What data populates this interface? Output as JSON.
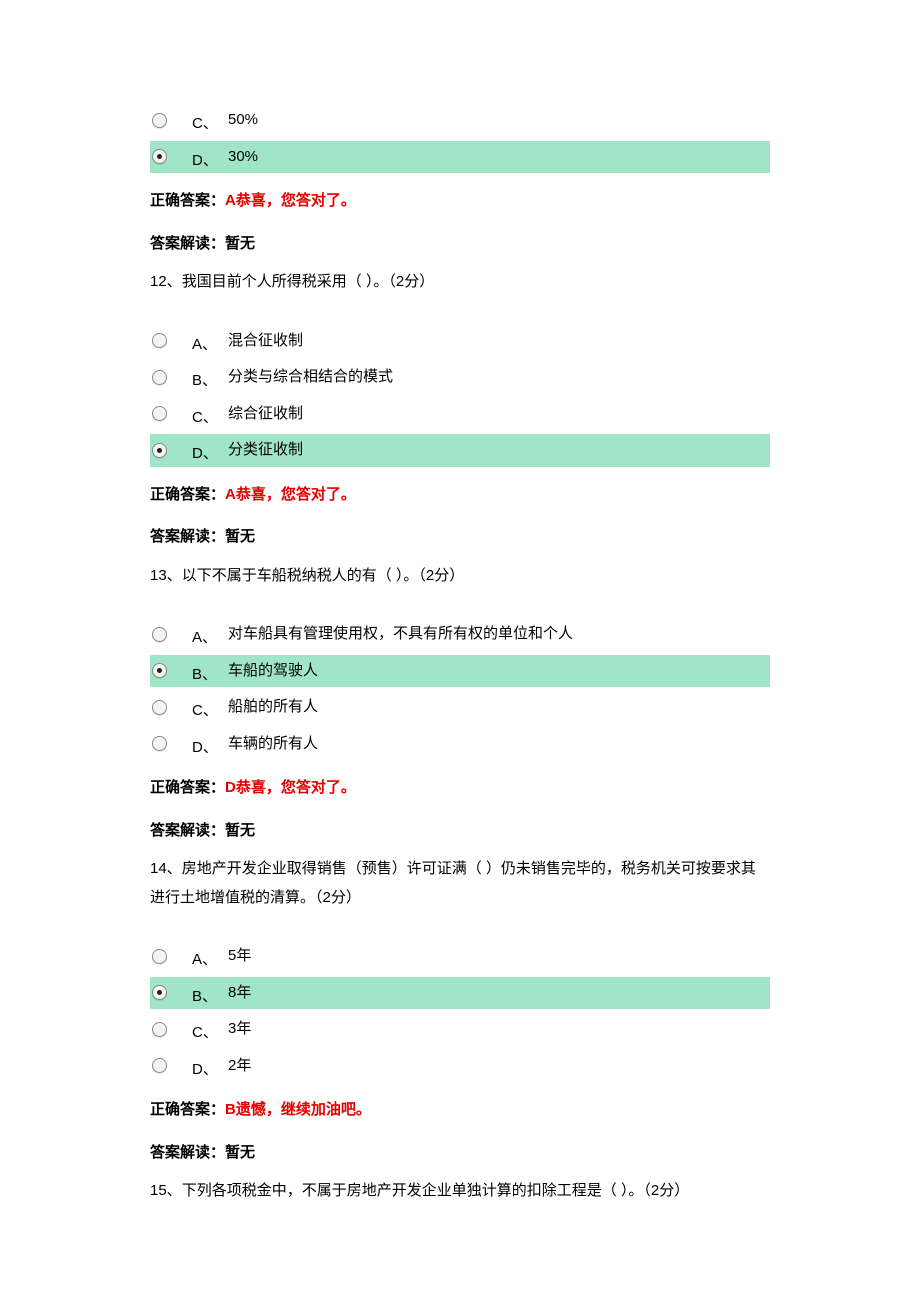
{
  "labels": {
    "correct_prefix": "正确答案：",
    "explain_prefix": "答案解读：",
    "explain_none": "暂无",
    "msg_correct": "恭喜，您答对了。",
    "msg_wrong": "遗憾，继续加油吧。"
  },
  "q_top": {
    "options": [
      {
        "letter": "C、",
        "text": "50%",
        "selected": false,
        "highlight": false
      },
      {
        "letter": "D、",
        "text": "30%",
        "selected": true,
        "highlight": true
      }
    ],
    "answer_key": "A",
    "answer_msg": "恭喜，您答对了。"
  },
  "q12": {
    "number": "12、",
    "stem": "我国目前个人所得税采用（ ）。（2分）",
    "options": [
      {
        "letter": "A、",
        "text": "混合征收制",
        "selected": false,
        "highlight": false
      },
      {
        "letter": "B、",
        "text": "分类与综合相结合的模式",
        "selected": false,
        "highlight": false
      },
      {
        "letter": "C、",
        "text": "综合征收制",
        "selected": false,
        "highlight": false
      },
      {
        "letter": "D、",
        "text": "分类征收制",
        "selected": true,
        "highlight": true
      }
    ],
    "answer_key": "A",
    "answer_msg": "恭喜，您答对了。"
  },
  "q13": {
    "number": "13、",
    "stem": "以下不属于车船税纳税人的有（ ）。（2分）",
    "options": [
      {
        "letter": "A、",
        "text": "对车船具有管理使用权，不具有所有权的单位和个人",
        "selected": false,
        "highlight": false
      },
      {
        "letter": "B、",
        "text": "车船的驾驶人",
        "selected": true,
        "highlight": true
      },
      {
        "letter": "C、",
        "text": "船舶的所有人",
        "selected": false,
        "highlight": false
      },
      {
        "letter": "D、",
        "text": "车辆的所有人",
        "selected": false,
        "highlight": false
      }
    ],
    "answer_key": "D",
    "answer_msg": "恭喜，您答对了。"
  },
  "q14": {
    "number": "14、",
    "stem": "房地产开发企业取得销售（预售）许可证满（ ）仍未销售完毕的，税务机关可按要求其进行土地增值税的清算。（2分）",
    "options": [
      {
        "letter": "A、",
        "text": "5年",
        "selected": false,
        "highlight": false
      },
      {
        "letter": "B、",
        "text": "8年",
        "selected": true,
        "highlight": true
      },
      {
        "letter": "C、",
        "text": "3年",
        "selected": false,
        "highlight": false
      },
      {
        "letter": "D、",
        "text": "2年",
        "selected": false,
        "highlight": false
      }
    ],
    "answer_key": "B",
    "answer_msg": "遗憾，继续加油吧。"
  },
  "q15": {
    "number": "15、",
    "stem": "下列各项税金中，不属于房地产开发企业单独计算的扣除工程是（ ）。（2分）"
  }
}
